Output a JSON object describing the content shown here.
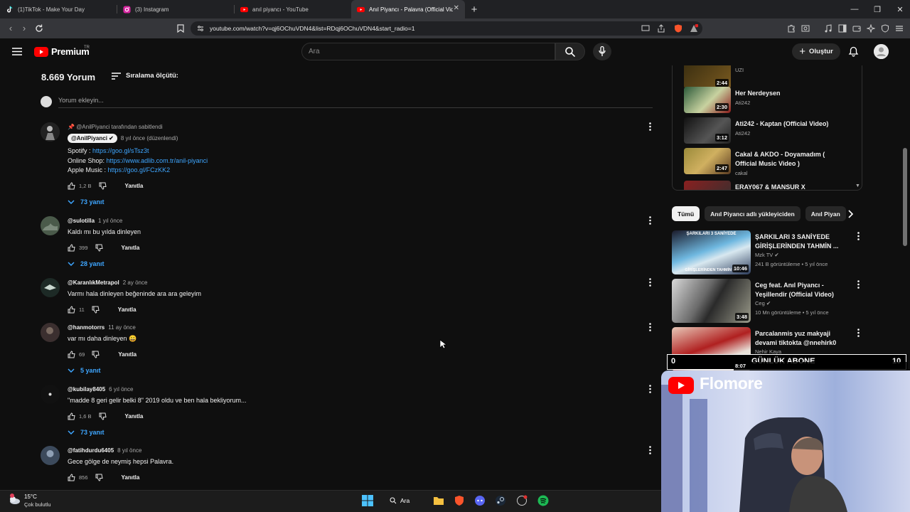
{
  "browser": {
    "tabs": [
      {
        "label": "(1)TikTok - Make Your Day",
        "icon": "tiktok-icon",
        "active": false
      },
      {
        "label": "(3) Instagram",
        "icon": "instagram-icon",
        "active": false
      },
      {
        "label": "anıl piyancı - YouTube",
        "icon": "youtube-icon",
        "active": false
      },
      {
        "label": "Anıl Piyancı - Palavra (Official Vid",
        "icon": "youtube-icon",
        "active": true
      }
    ],
    "url": "youtube.com/watch?v=qj6OChuVDN4&list=RDqj6OChuVDN4&start_radio=1"
  },
  "header": {
    "logo_text": "Premium",
    "logo_sup": "TR",
    "search_placeholder": "Ara",
    "create_label": "Oluştur"
  },
  "comments": {
    "count_label": "8.669 Yorum",
    "sort_label": "Sıralama ölçütü:",
    "add_placeholder": "Yorum ekleyin...",
    "items": [
      {
        "pinned_by": "@AnilPiyanci tarafından sabitlendi",
        "author": "@AnilPiyanci",
        "time": "8 yıl önce (düzenlendi)",
        "lines": [
          {
            "label": "Spotify : ",
            "link": "https://goo.gl/sTsz3t"
          },
          {
            "label": "Online Shop: ",
            "link": "https://www.adlib.com.tr/anil-piyanci"
          },
          {
            "label": "Apple Music : ",
            "link": "https://goo.gl/FCzKK2"
          }
        ],
        "likes": "1,2 B",
        "reply": "Yanıtla",
        "replies": "73 yanıt"
      },
      {
        "author": "@sulotilla",
        "time": "1 yıl önce",
        "text": "Kaldı mı bu yılda dinleyen",
        "likes": "399",
        "reply": "Yanıtla",
        "replies": "28 yanıt"
      },
      {
        "author": "@KaranlıkMetrapol",
        "time": "2 ay önce",
        "text": "Varmı hala dinleyen beğeninde ara ara geleyim",
        "likes": "11",
        "reply": "Yanıtla"
      },
      {
        "author": "@hanmotorrs",
        "time": "11 ay önce",
        "text": "var mı daha dinleyen 😄",
        "likes": "69",
        "reply": "Yanıtla",
        "replies": "5 yanıt"
      },
      {
        "author": "@kubilay8405",
        "time": "6 yıl önce",
        "text": "\"madde 8 geri gelir belki 8\" 2019 oldu ve ben hala bekliyorum...",
        "likes": "1,6 B",
        "reply": "Yanıtla",
        "replies": "73 yanıt"
      },
      {
        "author": "@fatihdurdu6405",
        "time": "8 yıl önce",
        "text": "Gece gölge de neymiş hepsi Palavra.",
        "likes": "856",
        "reply": "Yanıtla"
      }
    ]
  },
  "playlist": [
    {
      "title": "",
      "channel": "UZI",
      "duration": "2:44"
    },
    {
      "title": "Her Nerdeysen",
      "channel": "Ati242",
      "duration": "2:30"
    },
    {
      "title": "Ati242 - Kaptan (Official Video)",
      "channel": "Ati242",
      "duration": "3:12"
    },
    {
      "title": "Cakal & AKDO - Doyamadım ( Official Music Video )",
      "channel": "cakal",
      "duration": "2:47"
    },
    {
      "title": "ERAY067 & MANSUR X",
      "channel": "",
      "duration": ""
    }
  ],
  "chips": [
    "Tümü",
    "Anıl Piyancı adlı yükleyiciden",
    "Anıl Piyan"
  ],
  "recommendations": [
    {
      "thumb_text": "ŞARKILARI 3 SANİYEDE",
      "thumb_text2": "GİRİŞLERİNDEN TAHMİN ET",
      "title": "ŞARKILARI 3 SANİYEDE GİRİŞLERİNDEN TAHMİN ...",
      "channel": "Mzk TV",
      "views": "241 B görüntüleme",
      "age": "5 yıl önce",
      "duration": "10:46"
    },
    {
      "title": "Ceg feat. Anıl Piyancı - Yeşillendir (Official Video)",
      "channel": "Ceg",
      "views": "10 Mn görüntüleme",
      "age": "5 yıl önce",
      "duration": "3:48"
    },
    {
      "title": "Parcalanmis yuz makyaji devami tiktokta @nnehirk0",
      "channel": "Nehir Kaya",
      "views": "",
      "age": "",
      "duration": "8:07"
    }
  ],
  "overlay": {
    "left_num": "0",
    "label": "GÜNLÜK ABONE",
    "right_num": "10",
    "streamer": "Flomore"
  },
  "taskbar": {
    "temp": "15°C",
    "condition": "Çok bulutlu",
    "search": "Ara"
  },
  "colors": {
    "accent_red": "#ff0000",
    "link_blue": "#3ea6ff",
    "bg": "#0f0f0f"
  }
}
